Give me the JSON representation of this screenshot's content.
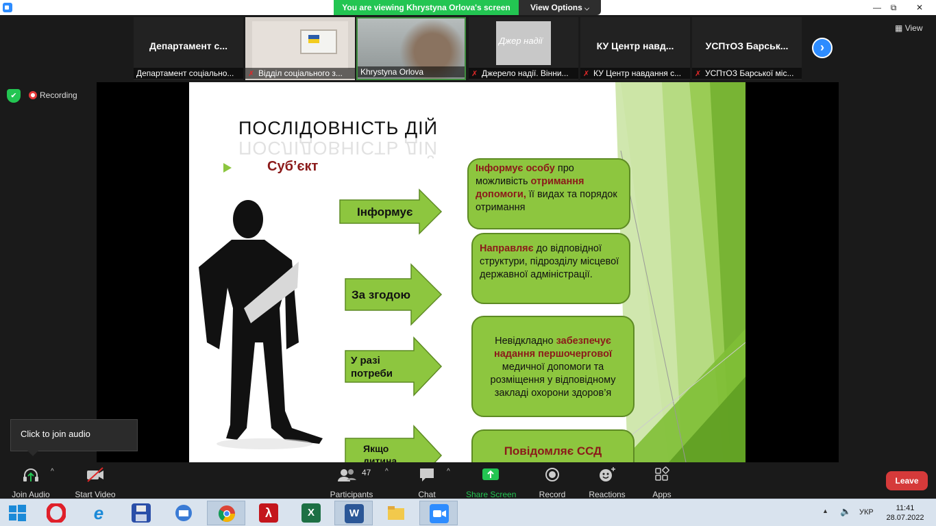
{
  "window": {
    "viewing_banner": "You are viewing Khrystyna Orlova's screen",
    "view_options": "View Options",
    "minimize_glyph": "—",
    "maximize_glyph": "⧉",
    "close_glyph": "✕"
  },
  "gallery": {
    "tiles": [
      {
        "big": "Департамент с...",
        "label": "Департамент соціально...",
        "muted": false
      },
      {
        "big": "",
        "label": "Відділ соціального з...",
        "muted": true
      },
      {
        "big": "",
        "label": "Khrystyna Orlova",
        "muted": false
      },
      {
        "big": "",
        "label": "Джерело надії. Вінни...",
        "muted": true,
        "logo_text": "Джер надії"
      },
      {
        "big": "КУ Центр навд...",
        "label": "КУ Центр навдання с...",
        "muted": true
      },
      {
        "big": "УСПтОЗ Барськ...",
        "label": "УСПтОЗ Барської міс...",
        "muted": true
      }
    ],
    "next_glyph": "›",
    "view_label": "View"
  },
  "recording": {
    "label": "Recording",
    "shield_glyph": "✔"
  },
  "slide": {
    "title": "ПОСЛІДОВНІСТЬ ДІЙ",
    "subject": "Суб’єкт",
    "arrows": [
      "Інформує",
      "За згодою",
      "У разі потреби",
      "Якщо дитина"
    ],
    "boxes": [
      {
        "parts": [
          [
            "red",
            "Інформує особу"
          ],
          [
            "",
            "про можливість "
          ],
          [
            "red",
            "отримання допомоги,"
          ],
          [
            "",
            " її видах та порядок отримання"
          ]
        ]
      },
      {
        "parts": [
          [
            "red",
            "Направляє"
          ],
          [
            "",
            " до відповідної структури, підрозділу місцевої державної адміністрації."
          ]
        ]
      },
      {
        "parts": [
          [
            "",
            "Невідкладно "
          ],
          [
            "red",
            "забезпечує надання першочергової"
          ],
          [
            "",
            " медичної допомоги та розміщення у відповідному закладі охорони здоров’я"
          ]
        ]
      },
      {
        "parts": [
          [
            "red",
            "Повідомляє ССД"
          ]
        ]
      }
    ]
  },
  "toolbar": {
    "join_audio": "Join Audio",
    "start_video": "Start Video",
    "participants": "Participants",
    "participants_count": "47",
    "chat": "Chat",
    "share_screen": "Share Screen",
    "record": "Record",
    "reactions": "Reactions",
    "apps": "Apps",
    "leave": "Leave",
    "caret": "^"
  },
  "tooltip": {
    "text": "Click to join audio"
  },
  "taskbar": {
    "apps": [
      "start",
      "opera",
      "internet-explorer",
      "save-disk",
      "zoom-thunderbird",
      "chrome",
      "acrobat",
      "excel",
      "word",
      "file-explorer",
      "zoom"
    ],
    "language": "УКР",
    "time": "11:41",
    "date": "28.07.2022"
  },
  "colors": {
    "accent": "#2d8cff",
    "share_green": "#23c552",
    "slide_green": "#8dc63f",
    "slide_red": "#8b1a1a",
    "leave_red": "#d53a3a"
  }
}
